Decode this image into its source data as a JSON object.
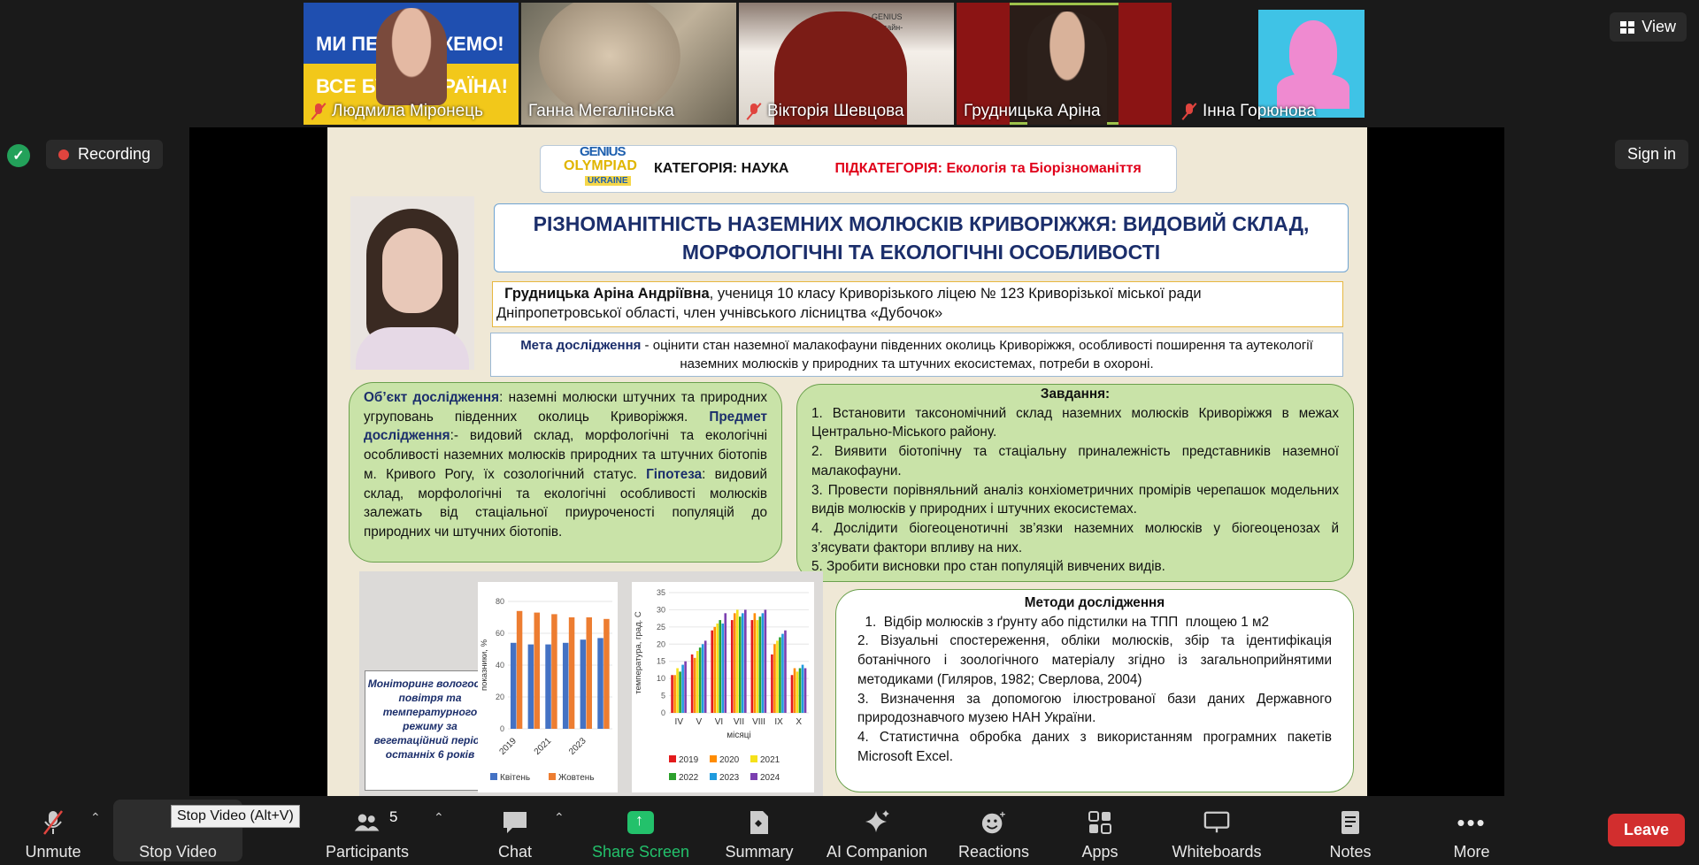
{
  "participants": [
    {
      "name": "Людмила Міронець",
      "muted": true,
      "banner1": "МИ ПЕРЕМОЖЕМО!",
      "banner2": "ВСЕ БУДЕ УКРАЇНА!"
    },
    {
      "name": "Ганна Мегалінська",
      "muted": false
    },
    {
      "name": "Вікторія Шевцова",
      "muted": true,
      "bg_text": "GENIUS\nОнлайн-\n2025"
    },
    {
      "name": "Грудницька Аріна",
      "muted": false,
      "active": true
    },
    {
      "name": "Інна Горюнова",
      "muted": true
    }
  ],
  "top": {
    "view_label": "View",
    "recording_label": "Recording",
    "signin_label": "Sign in"
  },
  "slide": {
    "logo": {
      "line1": "GENIUS",
      "line2": "OLYMPIAD",
      "line3": "UKRAINE"
    },
    "category": "КАТЕГОРІЯ: НАУКА",
    "subcategory": "ПІДКАТЕГОРІЯ: Екологія та Біорізноманіття",
    "title_line1": "РІЗНОМАНІТНІСТЬ НАЗЕМНИХ МОЛЮСКІВ КРИВОРІЖЖЯ: ВИДОВИЙ СКЛАД,",
    "title_line2": "МОРФОЛОГІЧНІ ТА ЕКОЛОГІЧНІ ОСОБЛИВОСТІ",
    "author_name": "Грудницька Аріна Андріївна",
    "author_rest": ",  учениця  10 класу Криворізького ліцею № 123 Криворізької міської ради",
    "author_line2": "Дніпропетровської області, член учнівського лісництва «Дубочок»",
    "goal_label": "Мета дослідження",
    "goal_text": " - оцінити стан наземної малакофауни південних околиць Криворіжжя, особливості поширення та аутекології наземних молюсків у  природних та штучних  екосистемах, потреби в охороні.",
    "object_label": "Об’єкт  дослідження",
    "object_text": ":  наземні  молюски  штучних  та природних угруповань південних  околиць Криворіжжя.",
    "subject_label": "Предмет дослідження",
    "subject_text": ":- видовий склад, морфологічні та екологічні особливості наземних молюсків природних та штучних біотопів м. Кривого Рогу, їх созологічний статус.",
    "hypothesis_label": "Гіпотеза",
    "hypothesis_text": ":  видовий  склад,  морфологічні  та  екологічні особливості  молюсків    залежать  від    стаціальної приуроченості  популяцій  до    природних  чи  штучних біотопів.",
    "tasks_title": "Завдання:",
    "tasks": [
      "1.  Встановити  таксономічний  склад  наземних  молюсків  Криворіжжя  в межах Центрально-Міського району.",
      "2. Виявити біотопічну та стаціальну приналежність  представників наземної малакофауни.",
      "3.  Провести  порівняльний  аналіз    конхіометричних  промірів  черепашок модельних видів молюсків у природних і штучних екосистемах.",
      "4.  Дослідити біогеоценотичні зв’язки наземних молюсків у біогеоценозах й з’ясувати фактори впливу на них.",
      "5. Зробити висновки про  стан популяцій  вивчених видів."
    ],
    "methods_title": "Методи дослідження",
    "methods": [
      "  1.  Відбір молюсків з ґрунту або підстилки на ТПП  площею 1 м2",
      "2.  Візуальні  спостереження,  обліки  молюсків,  збір  та  ідентифікація ботанічного  і  зоологічного  матеріалу  згідно  із  загальноприйнятими методиками (Гиляров, 1982; Сверлова, 2004)",
      "3.  Визначення  за  допомогою  ілюстрованої  бази  даних  Державного природознавчого музею НАН України.",
      "4.  Статистична  обробка  даних  з  використанням  програмних  пакетів Microsoft Excel."
    ],
    "callout_text": "Моніторинг вологості повітря та температурного режиму за вегетаційний період  останніх 6 років"
  },
  "chart_data": [
    {
      "type": "bar",
      "categories": [
        "2019",
        "2020",
        "2021",
        "2022",
        "2023",
        "2024"
      ],
      "tick_labels_shown": [
        "2019",
        "2021",
        "2023"
      ],
      "series": [
        {
          "name": "Квітень",
          "color": "#4472c4",
          "values": [
            54,
            53,
            53,
            54,
            56,
            57
          ]
        },
        {
          "name": "Жовтень",
          "color": "#ed7d31",
          "values": [
            74,
            73,
            72,
            70,
            70,
            69
          ]
        }
      ],
      "ylabel": "показники, %",
      "ylim": [
        0,
        80
      ],
      "yticks": [
        0,
        20,
        40,
        60,
        80
      ]
    },
    {
      "type": "bar",
      "categories": [
        "IV",
        "V",
        "VI",
        "VII",
        "VIII",
        "IX",
        "X"
      ],
      "series": [
        {
          "name": "2019",
          "color": "#e31a1c",
          "values": [
            11,
            17,
            24,
            27,
            27,
            17,
            11
          ]
        },
        {
          "name": "2020",
          "color": "#ff8c00",
          "values": [
            11,
            16,
            25,
            29,
            29,
            20,
            13
          ]
        },
        {
          "name": "2021",
          "color": "#f5e11a",
          "values": [
            13,
            18,
            26,
            30,
            27,
            21,
            12
          ]
        },
        {
          "name": "2022",
          "color": "#2ca02c",
          "values": [
            12,
            19,
            27,
            28,
            28,
            22,
            13
          ]
        },
        {
          "name": "2023",
          "color": "#1f9bde",
          "values": [
            14,
            20,
            26,
            29,
            29,
            23,
            14
          ]
        },
        {
          "name": "2024",
          "color": "#7b3fb0",
          "values": [
            15,
            21,
            29,
            30,
            30,
            24,
            13
          ]
        }
      ],
      "xlabel": "місяці",
      "ylabel": "температура, град. С",
      "ylim": [
        0,
        35
      ],
      "yticks": [
        0,
        5,
        10,
        15,
        20,
        25,
        30,
        35
      ]
    }
  ],
  "toolbar": {
    "unmute": "Unmute",
    "stop_video": "Stop Video",
    "participants": "Participants",
    "participants_count": "5",
    "chat": "Chat",
    "share_screen": "Share Screen",
    "summary": "Summary",
    "ai_companion": "AI Companion",
    "reactions": "Reactions",
    "apps": "Apps",
    "whiteboards": "Whiteboards",
    "notes": "Notes",
    "more": "More",
    "leave": "Leave",
    "tooltip": "Stop Video (Alt+V)"
  }
}
